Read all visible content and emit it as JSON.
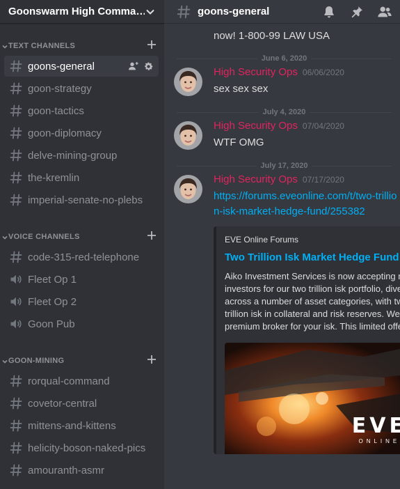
{
  "guild": {
    "name": "Goonswarm High Comma…"
  },
  "categories": [
    {
      "label": "TEXT CHANNELS",
      "channels": [
        {
          "name": "goons-general",
          "type": "text",
          "active": true
        },
        {
          "name": "goon-strategy",
          "type": "text"
        },
        {
          "name": "goon-tactics",
          "type": "text"
        },
        {
          "name": "goon-diplomacy",
          "type": "text"
        },
        {
          "name": "delve-mining-group",
          "type": "text"
        },
        {
          "name": "the-kremlin",
          "type": "text"
        },
        {
          "name": "imperial-senate-no-plebs",
          "type": "text"
        }
      ]
    },
    {
      "label": "VOICE CHANNELS",
      "channels": [
        {
          "name": "code-315-red-telephone",
          "type": "text"
        },
        {
          "name": "Fleet Op 1",
          "type": "voice"
        },
        {
          "name": "Fleet Op 2",
          "type": "voice"
        },
        {
          "name": "Goon Pub",
          "type": "voice"
        }
      ]
    },
    {
      "label": "GOON-MINING",
      "channels": [
        {
          "name": "rorqual-command",
          "type": "text"
        },
        {
          "name": "covetor-central",
          "type": "text"
        },
        {
          "name": "mittens-and-kittens",
          "type": "text"
        },
        {
          "name": "helicity-boson-naked-pics",
          "type": "text"
        },
        {
          "name": "amouranth-asmr",
          "type": "text"
        }
      ]
    }
  ],
  "header": {
    "channel_name": "goons-general"
  },
  "messages": {
    "continuation_text": "now! 1-800-99 LAW USA",
    "items": [
      {
        "divider": "June 6, 2020",
        "author": "High Security Ops",
        "timestamp": "06/06/2020",
        "text": "sex sex sex"
      },
      {
        "divider": "July 4, 2020",
        "author": "High Security Ops",
        "timestamp": "07/04/2020",
        "text": "WTF OMG"
      },
      {
        "divider": "July 17, 2020",
        "author": "High Security Ops",
        "timestamp": "07/17/2020",
        "link": "https://forums.eveonline.com/t/two-trillion-isk-market-hedge-fund/255382"
      }
    ]
  },
  "embed": {
    "provider": "EVE Online Forums",
    "title": "Two Trillion Isk Market Hedge Fund",
    "description": "Aiko Investment Services is now accepting new investors for our two trillion isk portfolio, diversified across a number of asset categories, with twenty trillion isk in collateral and risk reserves. We are the premium broker for your isk. This limited offer g...",
    "logo_text": "EVE",
    "logo_subtext": "ONLINE"
  },
  "colors": {
    "author": "#e2245e",
    "link": "#00aff4",
    "sidebar_bg": "#2f3136",
    "main_bg": "#36393f"
  },
  "icons": {
    "text_channel": "hash-icon",
    "voice_channel": "speaker-icon",
    "invite": "add-member-icon",
    "settings": "gear-icon",
    "notifications": "bell-icon",
    "pins": "pin-icon",
    "members": "members-icon"
  }
}
